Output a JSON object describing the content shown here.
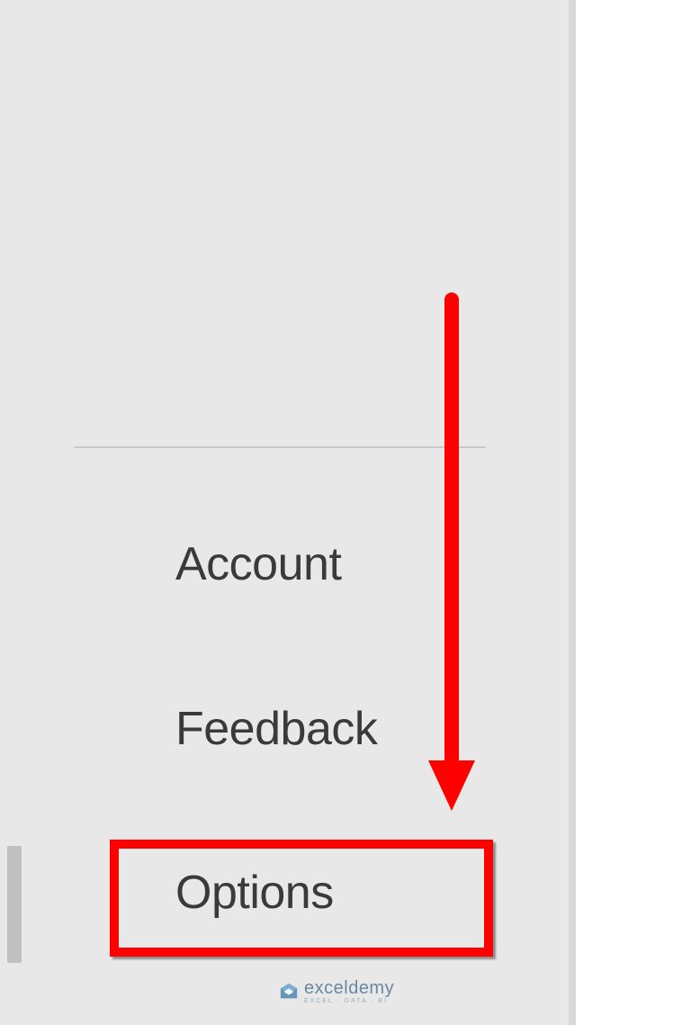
{
  "sidebar": {
    "items": [
      {
        "label": "Account"
      },
      {
        "label": "Feedback"
      },
      {
        "label": "Options"
      }
    ]
  },
  "annotation": {
    "highlight_target": "Options",
    "highlight_color": "#ff0000",
    "arrow_color": "#ff0000"
  },
  "watermark": {
    "brand": "exceldemy",
    "tagline": "EXCEL · DATA · BI"
  }
}
